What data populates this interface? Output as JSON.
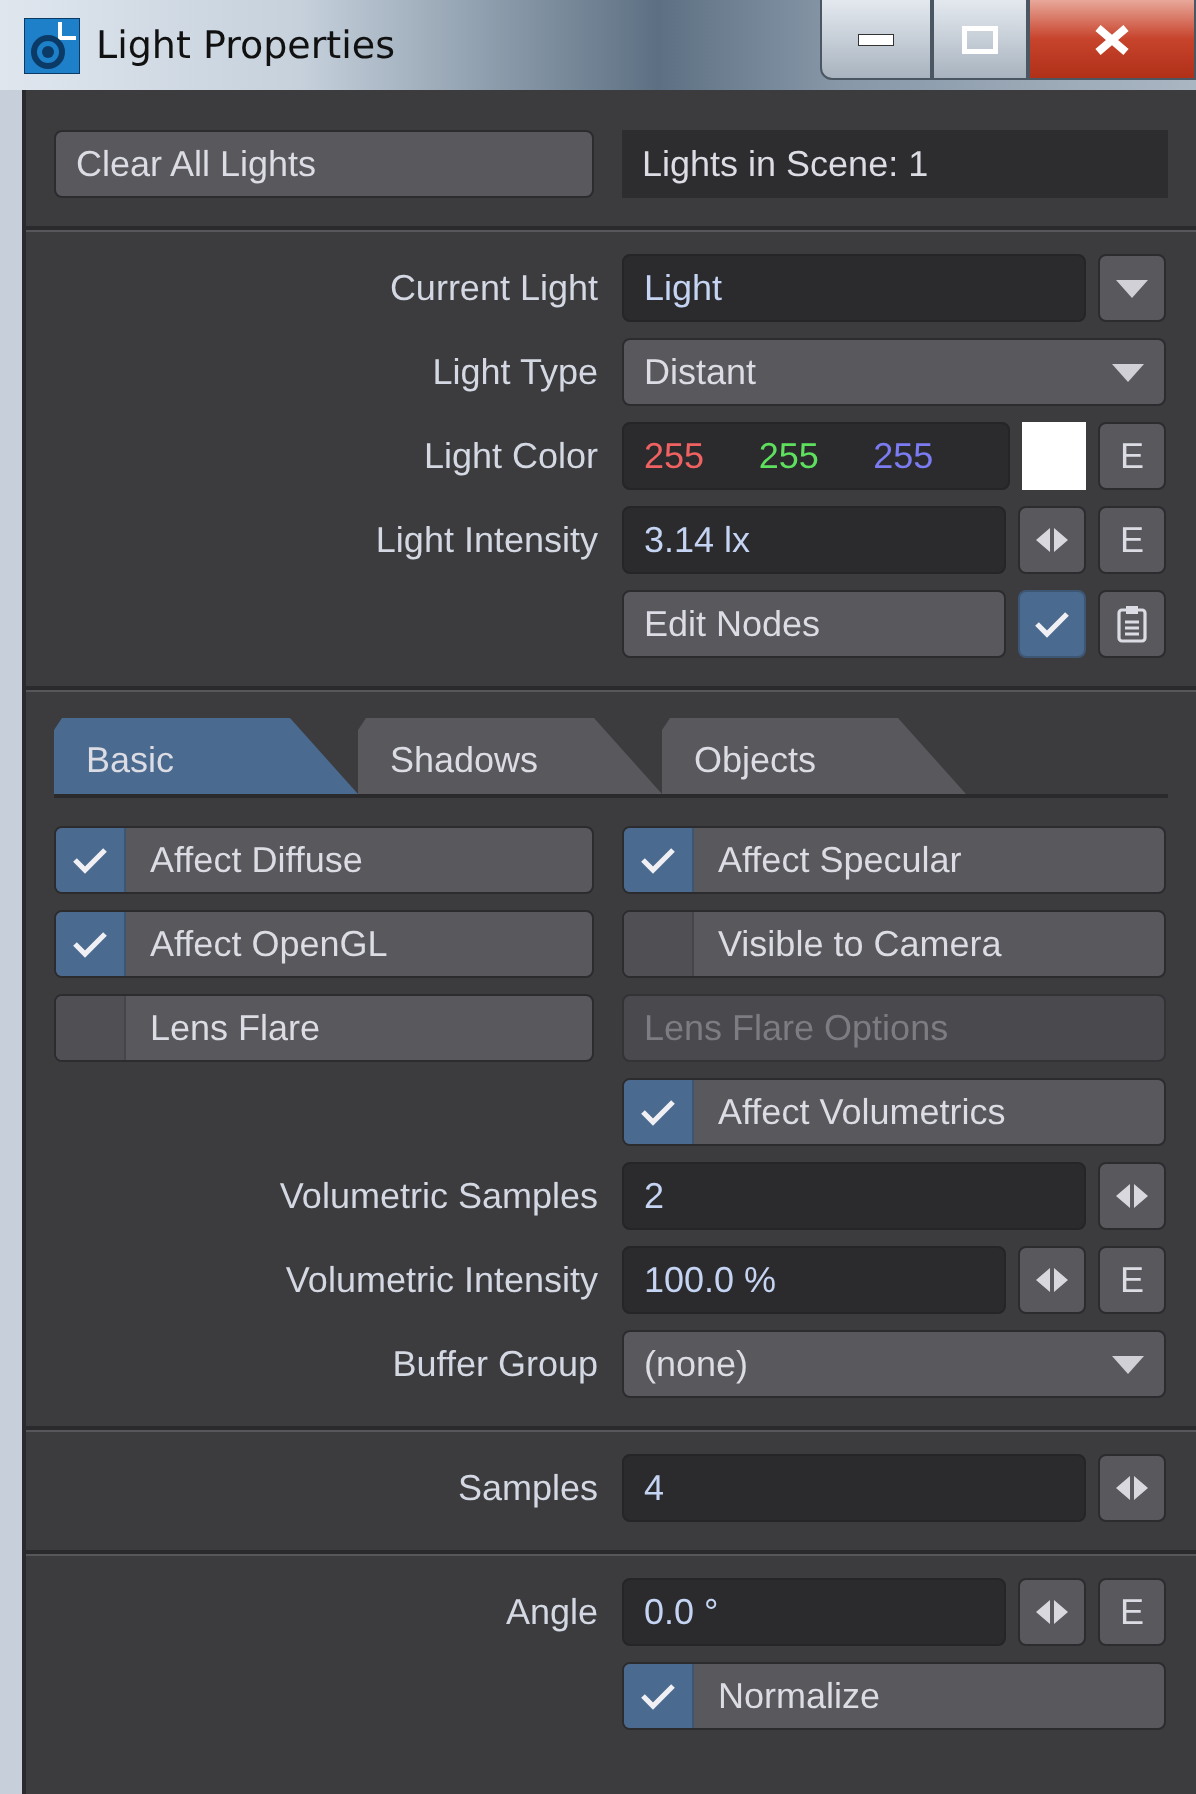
{
  "window": {
    "title": "Light Properties"
  },
  "header": {
    "clear_button": "Clear All Lights",
    "lights_count": "Lights in Scene: 1"
  },
  "sections": [
    {
      "rows": [
        {
          "kind": "list",
          "label": "Current Light",
          "value": "Light"
        },
        {
          "kind": "dropdown",
          "label": "Light Type",
          "value": "Distant"
        },
        {
          "kind": "color",
          "label": "Light Color",
          "channels": [
            "255",
            "255",
            "255"
          ],
          "color": "#ffffff",
          "envelope": "E"
        },
        {
          "kind": "number",
          "label": "Light Intensity",
          "value": "3.14 lx",
          "envelope": "E"
        },
        {
          "kind": "nodes",
          "button": "Edit Nodes",
          "checked": true
        }
      ]
    },
    {
      "tabs": [
        {
          "label": "Basic",
          "selected": true
        },
        {
          "label": "Shadows",
          "selected": false
        },
        {
          "label": "Objects",
          "selected": false
        }
      ],
      "options": [
        {
          "kind": "checkbox",
          "label": "Affect Diffuse",
          "checked": true
        },
        {
          "kind": "checkbox",
          "label": "Affect Specular",
          "checked": true
        },
        {
          "kind": "checkbox",
          "label": "Affect OpenGL",
          "checked": true
        },
        {
          "kind": "checkbox",
          "label": "Visible to Camera",
          "checked": false
        },
        {
          "kind": "checkbox",
          "label": "Lens Flare",
          "checked": false
        },
        {
          "kind": "button",
          "label": "Lens Flare Options",
          "disabled": true
        }
      ],
      "rows": [
        {
          "kind": "checkbox",
          "label": "Affect Volumetrics",
          "checked": true
        },
        {
          "kind": "number",
          "label": "Volumetric Samples",
          "value": "2"
        },
        {
          "kind": "number",
          "label": "Volumetric Intensity",
          "value": "100.0 %",
          "envelope": "E"
        },
        {
          "kind": "dropdown",
          "label": "Buffer Group",
          "value": "(none)"
        }
      ]
    },
    {
      "rows": [
        {
          "kind": "number",
          "label": "Samples",
          "value": "4"
        }
      ]
    },
    {
      "rows": [
        {
          "kind": "number",
          "label": "Angle",
          "value": "0.0 °",
          "envelope": "E"
        },
        {
          "kind": "checkbox",
          "label": "Normalize",
          "checked": true
        }
      ]
    }
  ]
}
